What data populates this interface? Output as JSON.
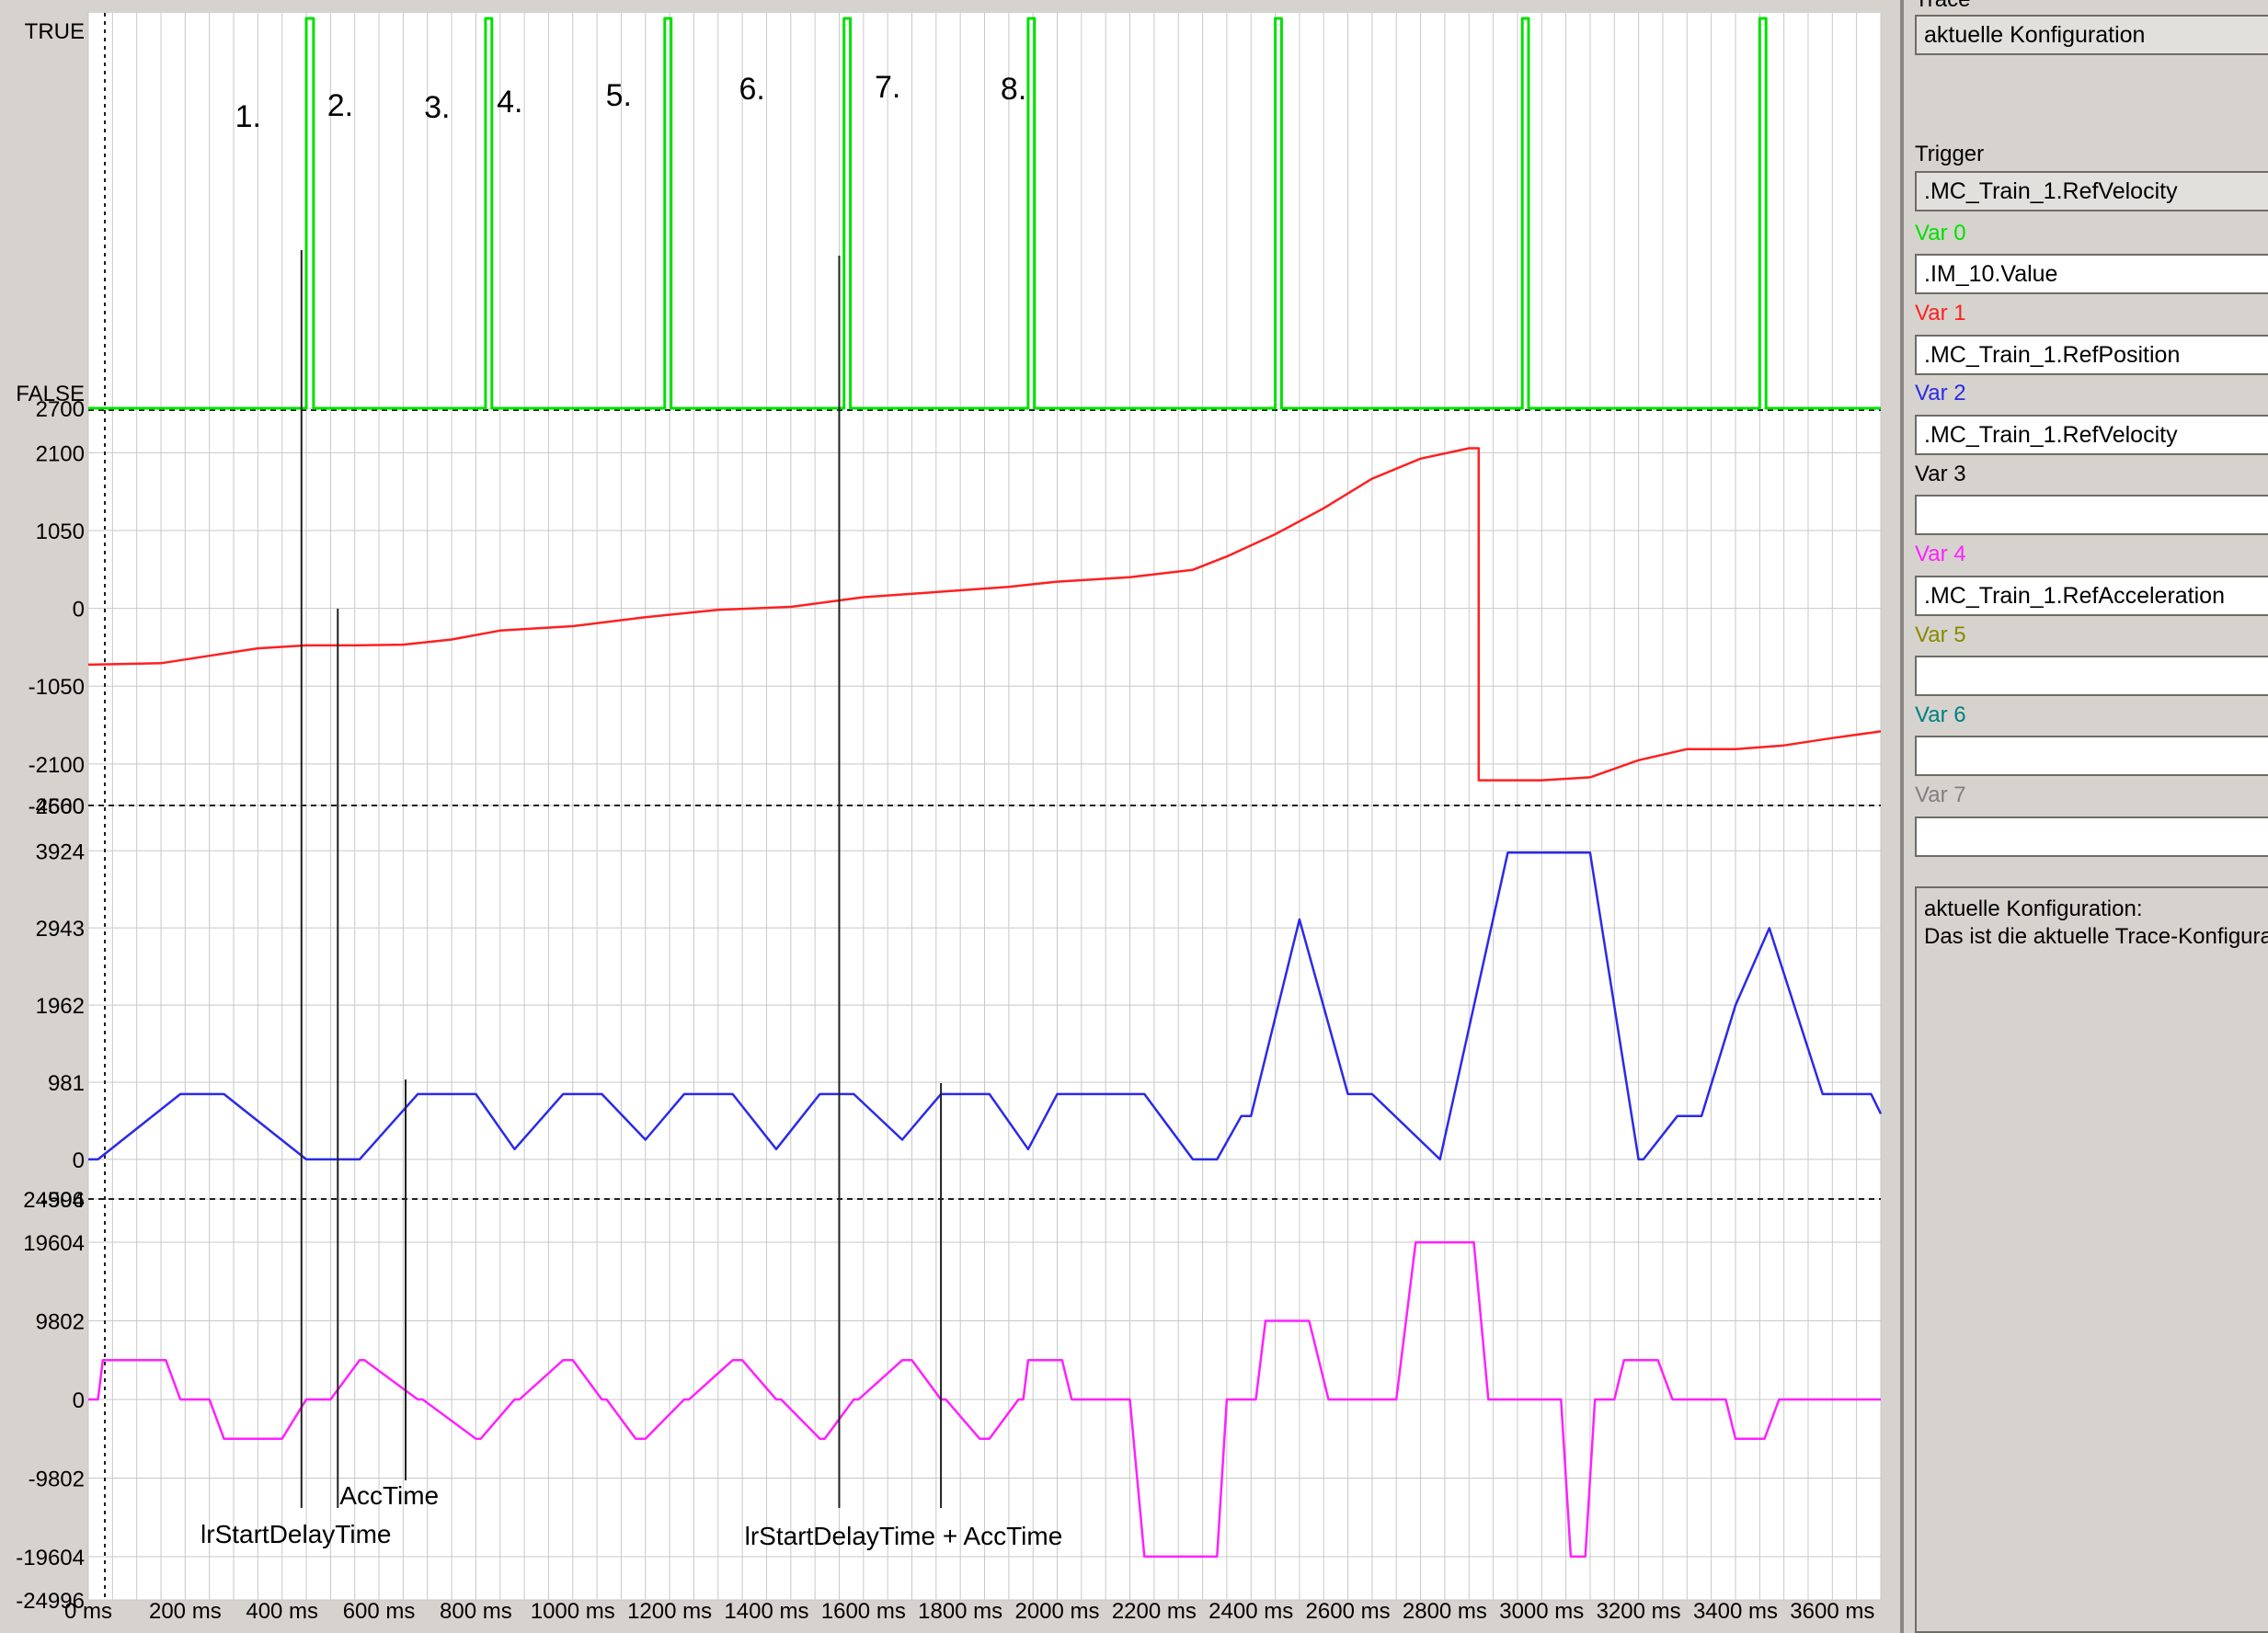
{
  "plot": {
    "bool_true_label": "TRUE",
    "bool_false_label": "FALSE",
    "event_markers": [
      "1.",
      "2.",
      "3.",
      "4.",
      "5.",
      "6.",
      "7.",
      "8."
    ],
    "annotations": {
      "start_delay": "lrStartDelayTime",
      "acc_time": "AccTime",
      "start_delay_plus_acc": "lrStartDelayTime + AccTime"
    },
    "time_axis_labels": [
      "0 ms",
      "200 ms",
      "400 ms",
      "600 ms",
      "800 ms",
      "1000 ms",
      "1200 ms",
      "1400 ms",
      "1600 ms",
      "1800 ms",
      "2000 ms",
      "2200 ms",
      "2400 ms",
      "2600 ms",
      "2800 ms",
      "3000 ms",
      "3200 ms",
      "3400 ms",
      "3600 ms"
    ],
    "colors": {
      "background": "#ffffff",
      "grid": "#c8c8c8",
      "var0": "#00e000",
      "var1": "#ff2020",
      "var2": "#2a2ae8",
      "var4": "#ff20ff",
      "cursor": "#202020"
    }
  },
  "chart_data": {
    "type": "line",
    "x_unit": "ms",
    "xlim": [
      0,
      3700
    ],
    "panels": [
      {
        "series": [
          {
            "name": ".IM_10.Value",
            "color": "#00e000",
            "kind": "boolean",
            "x": [
              0,
              450,
              450,
              465,
              465,
              820,
              820,
              833,
              833,
              1190,
              1190,
              1203,
              1203,
              1560,
              1560,
              1573,
              1573,
              1940,
              1940,
              1953,
              1953,
              2450,
              2450,
              2463,
              2463,
              2960,
              2960,
              2973,
              2973,
              3450,
              3450,
              3463,
              3463,
              3700
            ],
            "y": [
              0,
              0,
              1,
              1,
              0,
              0,
              1,
              1,
              0,
              0,
              1,
              1,
              0,
              0,
              1,
              1,
              0,
              0,
              1,
              1,
              0,
              0,
              1,
              1,
              0,
              0,
              1,
              1,
              0,
              0,
              1,
              1,
              0,
              0
            ]
          }
        ],
        "ytick_labels": [
          "TRUE",
          "FALSE"
        ]
      },
      {
        "series": [
          {
            "name": ".MC_Train_1.RefPosition",
            "color": "#ff2020",
            "x": [
              0,
              150,
              250,
              350,
              450,
              550,
              650,
              750,
              850,
              1000,
              1150,
              1300,
              1450,
              1600,
              1750,
              1900,
              2000,
              2150,
              2280,
              2350,
              2450,
              2550,
              2650,
              2750,
              2850,
              2870,
              2870,
              3000,
              3100,
              3200,
              3300,
              3400,
              3500,
              3600,
              3700
            ],
            "y": [
              -760,
              -740,
              -640,
              -540,
              -500,
              -500,
              -490,
              -420,
              -300,
              -240,
              -120,
              -20,
              20,
              150,
              220,
              290,
              360,
              420,
              520,
              700,
              1000,
              1350,
              1750,
              2020,
              2160,
              2160,
              -2320,
              -2320,
              -2280,
              -2050,
              -1900,
              -1900,
              -1850,
              -1750,
              -1660
            ]
          }
        ],
        "ytick_labels": [
          "2700",
          "2100",
          "1050",
          "0",
          "-1050",
          "-2100",
          "-2660"
        ],
        "ylim": [
          -2660,
          2700
        ]
      },
      {
        "series": [
          {
            "name": ".MC_Train_1.RefVelocity",
            "color": "#2a2ae8",
            "x": [
              0,
              20,
              190,
              280,
              450,
              560,
              680,
              800,
              880,
              980,
              1060,
              1150,
              1230,
              1330,
              1420,
              1510,
              1580,
              1680,
              1760,
              1860,
              1940,
              2000,
              2100,
              2180,
              2280,
              2330,
              2380,
              2400,
              2500,
              2600,
              2650,
              2790,
              2930,
              3100,
              3200,
              3210,
              3280,
              3330,
              3400,
              3470,
              3580,
              3680,
              3700
            ],
            "y": [
              0,
              0,
              830,
              830,
              0,
              0,
              830,
              830,
              130,
              830,
              830,
              250,
              830,
              830,
              130,
              830,
              830,
              250,
              830,
              830,
              130,
              830,
              830,
              830,
              0,
              0,
              550,
              550,
              3050,
              830,
              830,
              0,
              3900,
              3900,
              0,
              0,
              550,
              550,
              1960,
              2940,
              830,
              830,
              580
            ]
          }
        ],
        "ytick_labels": [
          "4500",
          "3924",
          "2943",
          "1962",
          "981",
          "0",
          "-504"
        ],
        "ylim": [
          -504,
          4500
        ]
      },
      {
        "series": [
          {
            "name": ".MC_Train_1.RefAcceleration",
            "color": "#ff20ff",
            "x": [
              0,
              20,
              30,
              160,
              190,
              250,
              280,
              400,
              450,
              500,
              560,
              570,
              680,
              690,
              800,
              810,
              880,
              890,
              980,
              1000,
              1060,
              1070,
              1130,
              1150,
              1230,
              1240,
              1330,
              1350,
              1420,
              1430,
              1510,
              1520,
              1580,
              1590,
              1680,
              1700,
              1760,
              1770,
              1840,
              1860,
              1920,
              1930,
              1940,
              2010,
              2030,
              2150,
              2180,
              2330,
              2350,
              2410,
              2430,
              2520,
              2560,
              2700,
              2740,
              2860,
              2890,
              3040,
              3060,
              3090,
              3110,
              3150,
              3170,
              3240,
              3270,
              3380,
              3400,
              3460,
              3490,
              3580,
              3700
            ],
            "y": [
              0,
              0,
              4900,
              4900,
              0,
              0,
              -4900,
              -4900,
              0,
              0,
              4900,
              4900,
              0,
              0,
              -4900,
              -4900,
              0,
              0,
              4900,
              4900,
              0,
              0,
              -4900,
              -4900,
              0,
              0,
              4900,
              4900,
              0,
              0,
              -4900,
              -4900,
              0,
              0,
              4900,
              4900,
              0,
              0,
              -4900,
              -4900,
              0,
              0,
              4900,
              4900,
              0,
              0,
              -19600,
              -19600,
              0,
              0,
              9800,
              9800,
              0,
              0,
              19600,
              19600,
              0,
              0,
              -19600,
              -19600,
              0,
              0,
              4900,
              4900,
              0,
              0,
              -4900,
              -4900,
              0,
              0,
              0
            ]
          }
        ],
        "ytick_labels": [
          "24996",
          "19604",
          "9802",
          "0",
          "-9802",
          "-19604",
          "-24996"
        ],
        "ylim": [
          -24996,
          24996
        ]
      }
    ]
  },
  "side_panel": {
    "trace_label": "Trace",
    "trace_value": "aktuelle Konfiguration",
    "trigger_label": "Trigger",
    "trigger_value": ".MC_Train_1.RefVelocity",
    "vars": [
      {
        "label": "Var 0",
        "value": ".IM_10.Value",
        "color": "#00e000"
      },
      {
        "label": "Var 1",
        "value": ".MC_Train_1.RefPosition",
        "color": "#ff2020"
      },
      {
        "label": "Var 2",
        "value": ".MC_Train_1.RefVelocity",
        "color": "#2a2ae8"
      },
      {
        "label": "Var 3",
        "value": "",
        "color": "#000000"
      },
      {
        "label": "Var 4",
        "value": ".MC_Train_1.RefAcceleration",
        "color": "#ff20ff"
      },
      {
        "label": "Var 5",
        "value": "",
        "color": "#8a8a00"
      },
      {
        "label": "Var 6",
        "value": "",
        "color": "#008080"
      },
      {
        "label": "Var 7",
        "value": "",
        "color": "#808080"
      }
    ],
    "description_title": "aktuelle Konfiguration:",
    "description_text": "Das ist die aktuelle Trace-Konfiguration"
  }
}
